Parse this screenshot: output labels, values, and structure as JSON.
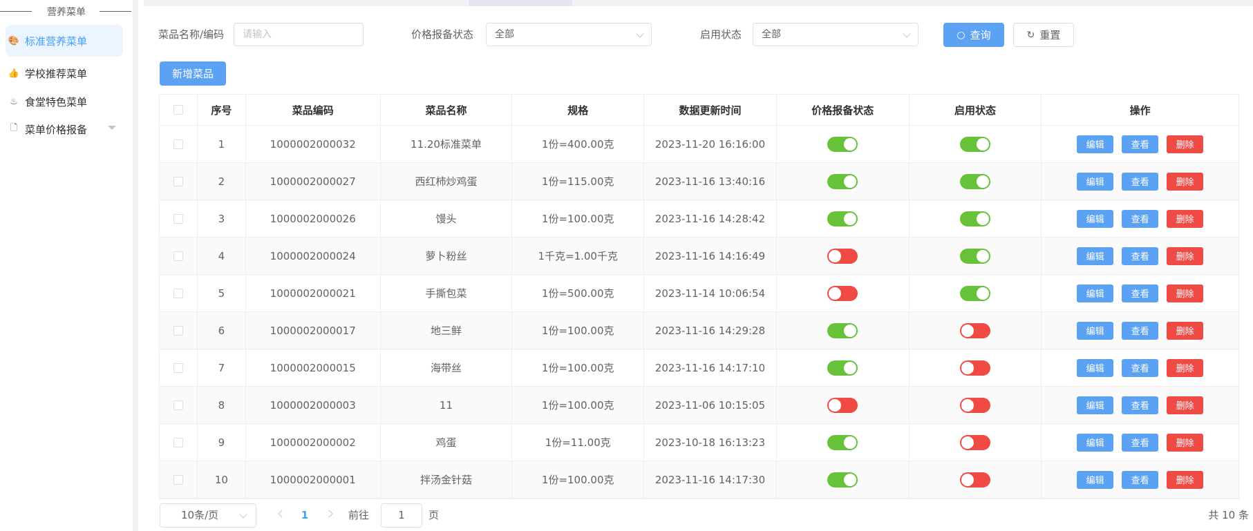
{
  "sidebar": {
    "title": "营养菜单",
    "items": [
      {
        "label": "标准营养菜单",
        "icon": "palette-icon",
        "glyph": "🎨",
        "active": true
      },
      {
        "label": "学校推荐菜单",
        "icon": "thumbs-up-icon",
        "glyph": "👍",
        "active": false
      },
      {
        "label": "食堂特色菜单",
        "icon": "fire-icon",
        "glyph": "♨",
        "active": false
      },
      {
        "label": "菜单价格报备",
        "icon": "note-icon",
        "glyph": "🗋",
        "active": false
      }
    ]
  },
  "search": {
    "name_label": "菜品名称/编码",
    "name_placeholder": "请输入",
    "price_label": "价格报备状态",
    "price_value": "全部",
    "enable_label": "启用状态",
    "enable_value": "全部",
    "query_label": "查询",
    "reset_label": "重置"
  },
  "toolbar": {
    "add_label": "新增菜品"
  },
  "table": {
    "columns": [
      "序号",
      "菜品编码",
      "菜品名称",
      "规格",
      "数据更新时间",
      "价格报备状态",
      "启用状态",
      "操作"
    ],
    "actions": {
      "edit": "编辑",
      "view": "查看",
      "delete": "删除"
    },
    "rows": [
      {
        "idx": "1",
        "code": "1000002000032",
        "name": "11.20标准菜单",
        "spec": "1份=400.00克",
        "time": "2023-11-20 16:16:00",
        "price_on": true,
        "enabled": true
      },
      {
        "idx": "2",
        "code": "1000002000027",
        "name": "西红柿炒鸡蛋",
        "spec": "1份=115.00克",
        "time": "2023-11-16 13:40:16",
        "price_on": true,
        "enabled": true
      },
      {
        "idx": "3",
        "code": "1000002000026",
        "name": "馒头",
        "spec": "1份=100.00克",
        "time": "2023-11-16 14:28:42",
        "price_on": true,
        "enabled": true
      },
      {
        "idx": "4",
        "code": "1000002000024",
        "name": "萝卜粉丝",
        "spec": "1千克=1.00千克",
        "time": "2023-11-16 14:16:49",
        "price_on": false,
        "enabled": true
      },
      {
        "idx": "5",
        "code": "1000002000021",
        "name": "手撕包菜",
        "spec": "1份=500.00克",
        "time": "2023-11-14 10:06:54",
        "price_on": false,
        "enabled": true
      },
      {
        "idx": "6",
        "code": "1000002000017",
        "name": "地三鲜",
        "spec": "1份=100.00克",
        "time": "2023-11-16 14:29:28",
        "price_on": true,
        "enabled": false
      },
      {
        "idx": "7",
        "code": "1000002000015",
        "name": "海带丝",
        "spec": "1份=100.00克",
        "time": "2023-11-16 14:17:10",
        "price_on": true,
        "enabled": false
      },
      {
        "idx": "8",
        "code": "1000002000003",
        "name": "11",
        "spec": "1份=100.00克",
        "time": "2023-11-06 10:15:05",
        "price_on": false,
        "enabled": false
      },
      {
        "idx": "9",
        "code": "1000002000002",
        "name": "鸡蛋",
        "spec": "1份=11.00克",
        "time": "2023-10-18 16:13:23",
        "price_on": true,
        "enabled": false
      },
      {
        "idx": "10",
        "code": "1000002000001",
        "name": "拌汤金针菇",
        "spec": "1份=100.00克",
        "time": "2023-11-16 14:17:30",
        "price_on": true,
        "enabled": false
      }
    ]
  },
  "pagination": {
    "page_size": "10条/页",
    "current_page": "1",
    "goto_prefix": "前往",
    "goto_value": "1",
    "goto_suffix": "页",
    "total": "共 10 条"
  },
  "colors": {
    "primary": "#5ba2f4",
    "switch_on": "#67c23a",
    "switch_off": "#f04a44",
    "danger": "#f04a44"
  }
}
